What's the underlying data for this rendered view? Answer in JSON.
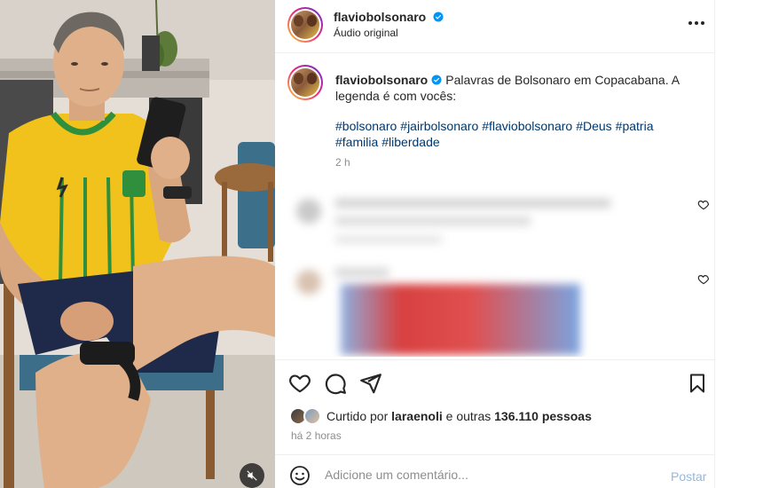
{
  "post": {
    "username": "flaviobolsonaro",
    "audio_label": "Áudio original",
    "caption": "Palavras de Bolsonaro em Copacabana. A legenda é com vocês:",
    "hashtags": [
      "#bolsonaro",
      "#jairbolsonaro",
      "#flaviobolsonaro",
      "#Deus",
      "#patria",
      "#familia",
      "#liberdade"
    ],
    "caption_time": "2 h",
    "liked_by_prefix": "Curtido por",
    "liked_by_user": "laraenoli",
    "liked_by_connector": "e outras",
    "likes_count": "136.110 pessoas",
    "time_ago": "há 2 horas"
  },
  "comment_box": {
    "placeholder": "Adicione um comentário...",
    "post_label": "Postar"
  },
  "icons": {
    "more": "more-options-icon",
    "verified": "verified-badge-icon",
    "like": "heart-icon",
    "comment": "comment-icon",
    "share": "share-icon",
    "save": "bookmark-icon",
    "emoji": "emoji-icon",
    "mute": "muted-speaker-icon"
  },
  "colors": {
    "verified_blue": "#0095f6",
    "hashtag_blue": "#00376b",
    "post_button": "#8fb9e6",
    "muted_text": "#8e8e8e"
  }
}
